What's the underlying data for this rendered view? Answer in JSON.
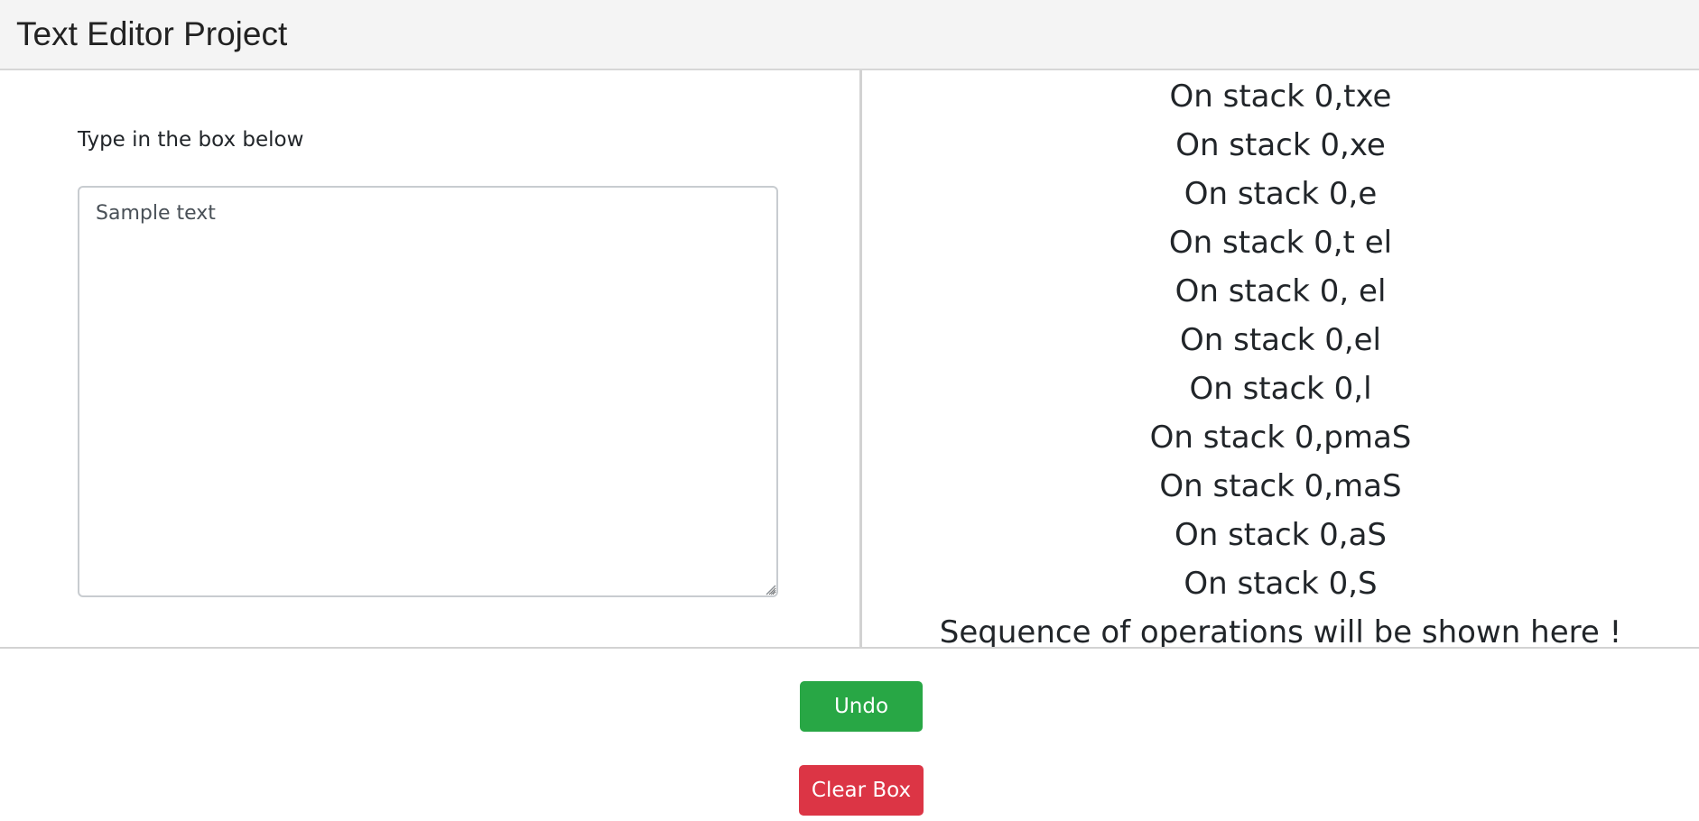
{
  "header": {
    "title": "Text Editor Project"
  },
  "editor": {
    "prompt": "Type in the box below",
    "value": "Sample text"
  },
  "operations": {
    "items": [
      "On stack 0,txe",
      "On stack 0,xe",
      "On stack 0,e",
      "On stack 0,t el",
      "On stack 0, el",
      "On stack 0,el",
      "On stack 0,l",
      "On stack 0,pmaS",
      "On stack 0,maS",
      "On stack 0,aS",
      "On stack 0,S",
      "Sequence of operations will be shown here !"
    ]
  },
  "buttons": {
    "undo_label": "Undo",
    "clear_label": "Clear Box"
  },
  "colors": {
    "undo": "#28a745",
    "clear": "#dc3545",
    "header_bg": "#f4f4f4"
  }
}
